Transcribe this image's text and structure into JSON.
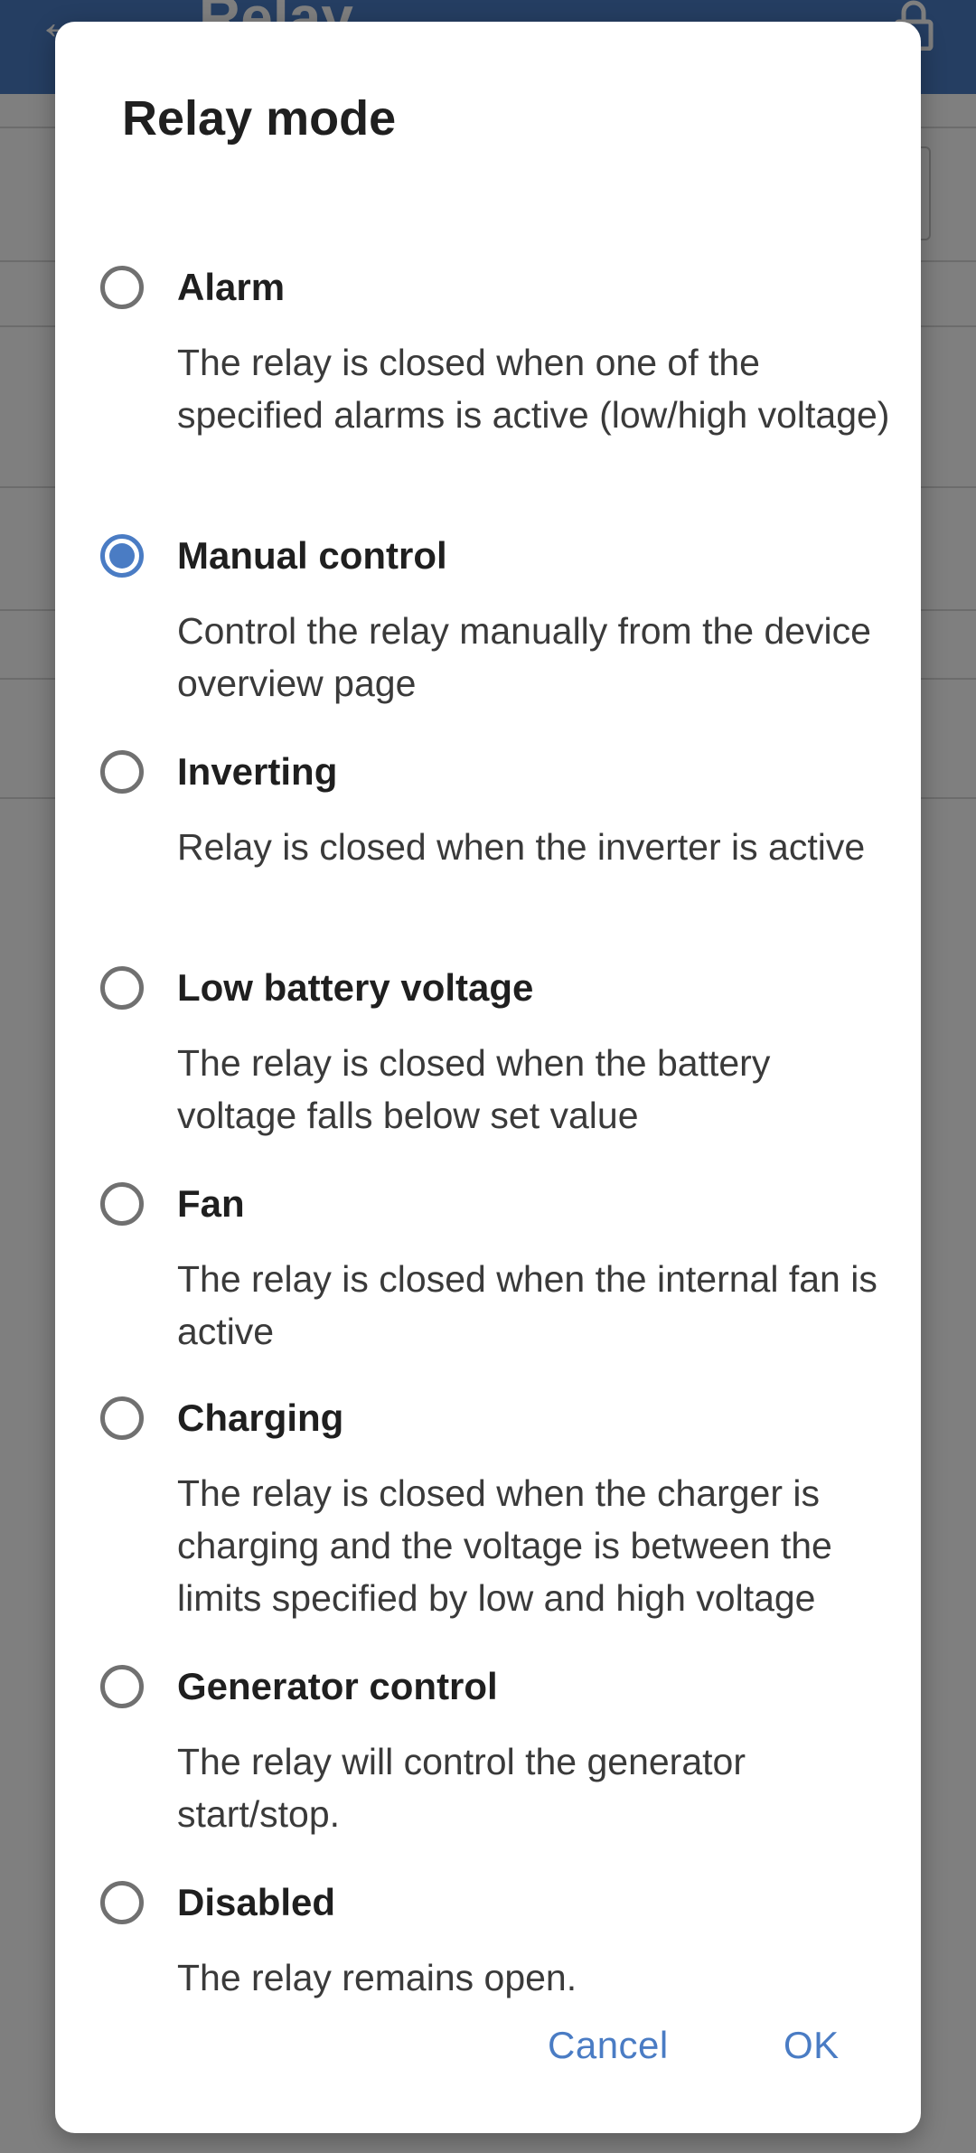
{
  "app": {
    "title": "Relay",
    "back_icon": "arrow-back-icon",
    "lock_icon": "lock-icon"
  },
  "dialog": {
    "title": "Relay mode",
    "options": [
      {
        "label": "Alarm",
        "description": "The relay is closed when one of the specified alarms is active (low/high voltage)",
        "selected": false
      },
      {
        "label": "Manual control",
        "description": "Control the relay manually from the device overview page",
        "selected": true
      },
      {
        "label": "Inverting",
        "description": "Relay is closed when the inverter is active",
        "selected": false
      },
      {
        "label": "Low battery voltage",
        "description": "The relay is closed when the battery voltage falls below set value",
        "selected": false
      },
      {
        "label": "Fan",
        "description": "The relay is closed when the internal fan is active",
        "selected": false
      },
      {
        "label": "Charging",
        "description": "The relay is closed when the charger is charging and the voltage is between the limits specified by low and high voltage",
        "selected": false
      },
      {
        "label": "Generator control",
        "description": "The relay will control the generator start/stop.",
        "selected": false
      },
      {
        "label": "Disabled",
        "description": "The relay remains open.",
        "selected": false
      }
    ],
    "cancel_label": "Cancel",
    "ok_label": "OK"
  },
  "colors": {
    "accent": "#4a7cc4",
    "radio_unselected": "#707070",
    "scrim": "rgba(0,0,0,0.5)"
  }
}
